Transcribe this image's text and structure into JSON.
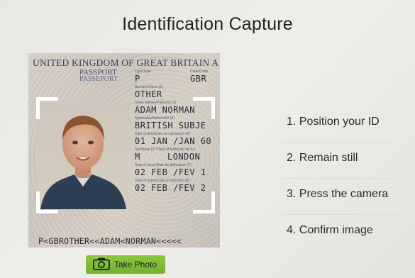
{
  "title": "Identification Capture",
  "document": {
    "country": "UNITED KINGDOM OF GREAT BRITAIN A",
    "passport_label": "PASSPORT",
    "passport_label_fr": "PASSEPORT",
    "type_label": "Type/Type",
    "type_value": "P",
    "code_label": "Code/Code",
    "code_value": "GBR",
    "surname_label": "Surname/Nom (1)",
    "surname_value": "OTHER",
    "given_label": "Given names/Prénoms (2)",
    "given_value": "ADAM NORMAN",
    "nationality_label": "Nationality/Nationalité (3)",
    "nationality_value": "BRITISH SUBJE",
    "dob_label": "Date of birth/Date de naissance (4)",
    "dob_value": "01 JAN /JAN 60",
    "sex_label": "Sex/Sexe (5)    Place of birth/Lieu de na",
    "sex_value": "M",
    "pob_value": "LONDON",
    "issue_label": "Date of issue/Date de délivrance (7)",
    "issue_value": "02 FEB /FEV 1",
    "expiry_label": "Date of expiry/Date d'expiration (8)",
    "expiry_value": "02 FEB /FEV 2",
    "mrz": "P<GBROTHER<<ADAM<NORMAN<<<<<"
  },
  "steps": [
    "1. Position your ID",
    "2. Remain still",
    "3. Press the camera",
    "4. Confirm image"
  ],
  "take_photo": {
    "label": "Take Photo",
    "icon": "camera-icon",
    "color": "#7dbb33"
  }
}
